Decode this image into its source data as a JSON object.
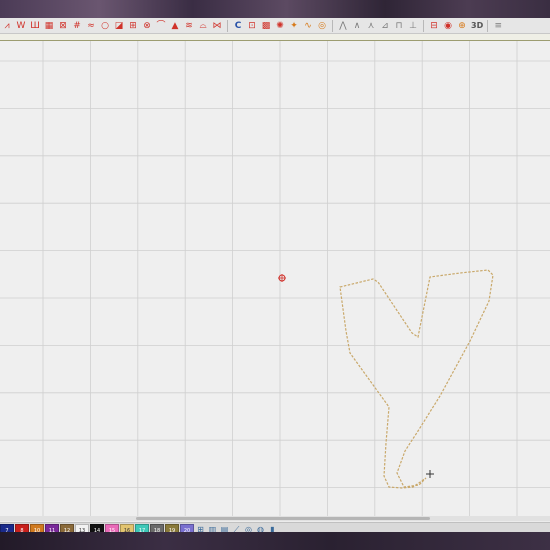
{
  "toolbar": {
    "tools": [
      {
        "name": "satin-column-tool",
        "glyph": "⩘",
        "color": "red"
      },
      {
        "name": "zigzag-tool",
        "glyph": "W",
        "color": "red"
      },
      {
        "name": "running-stitch-tool",
        "glyph": "Ш",
        "color": "red"
      },
      {
        "name": "fill-pattern-tool",
        "glyph": "▦",
        "color": "red"
      },
      {
        "name": "cross-stitch-tool",
        "glyph": "⊠",
        "color": "red"
      },
      {
        "name": "grid-fill-tool",
        "glyph": "#",
        "color": "red"
      },
      {
        "name": "wave-fill-tool",
        "glyph": "≈",
        "color": "red"
      },
      {
        "name": "ring-tool",
        "glyph": "○",
        "color": "red"
      },
      {
        "name": "motif-tool",
        "glyph": "◪",
        "color": "red"
      },
      {
        "name": "lattice-tool",
        "glyph": "⊞",
        "color": "red"
      },
      {
        "name": "diamond-fill-tool",
        "glyph": "⊗",
        "color": "red"
      },
      {
        "name": "arch-tool",
        "glyph": "⌒",
        "color": "red"
      },
      {
        "name": "triangle-fill-tool",
        "glyph": "▲",
        "color": "red"
      },
      {
        "name": "chevron-tool",
        "glyph": "≋",
        "color": "red"
      },
      {
        "name": "scallop-tool",
        "glyph": "⌓",
        "color": "red"
      },
      {
        "name": "tatami-tool",
        "glyph": "⋈",
        "color": "red"
      },
      {
        "name": "crescent-tool",
        "glyph": "C",
        "color": "blue"
      },
      {
        "name": "stitch-path-tool",
        "glyph": "⊡",
        "color": "red"
      },
      {
        "name": "weave-tool",
        "glyph": "▩",
        "color": "red"
      },
      {
        "name": "radial-fill-tool",
        "glyph": "✺",
        "color": "red"
      },
      {
        "name": "star-tool",
        "glyph": "✦",
        "color": "orange"
      },
      {
        "name": "wave-line-tool",
        "glyph": "∿",
        "color": "orange"
      },
      {
        "name": "spiral-tool",
        "glyph": "◎",
        "color": "orange"
      },
      {
        "name": "compass-tool",
        "glyph": "⋀",
        "color": "gray"
      },
      {
        "name": "angle-tool",
        "glyph": "∧",
        "color": "gray"
      },
      {
        "name": "peak-tool",
        "glyph": "⋏",
        "color": "gray"
      },
      {
        "name": "chart-tool",
        "glyph": "⊿",
        "color": "gray"
      },
      {
        "name": "hoop-tool",
        "glyph": "⊓",
        "color": "gray"
      },
      {
        "name": "measure-tool",
        "glyph": "⊥",
        "color": "gray"
      },
      {
        "name": "grid-toggle-tool",
        "glyph": "⊟",
        "color": "red"
      },
      {
        "name": "color-wheel-tool",
        "glyph": "◉",
        "color": "red"
      },
      {
        "name": "zoom-tool",
        "glyph": "⊕",
        "color": "orange"
      }
    ],
    "view_3d_label": "3D"
  },
  "palette": {
    "swatches": [
      {
        "label": "7",
        "color": "#1a2a8a"
      },
      {
        "label": "8",
        "color": "#c8201c"
      },
      {
        "label": "10",
        "color": "#d07a20"
      },
      {
        "label": "11",
        "color": "#7a2a9a"
      },
      {
        "label": "12",
        "color": "#8a6a3a"
      },
      {
        "label": "13",
        "color": "#f2f2f2"
      },
      {
        "label": "14",
        "color": "#111111"
      },
      {
        "label": "15",
        "color": "#e96ab8"
      },
      {
        "label": "16",
        "color": "#e2c470"
      },
      {
        "label": "17",
        "color": "#3ec8b8"
      },
      {
        "label": "18",
        "color": "#6a6a6a"
      },
      {
        "label": "19",
        "color": "#8a7a3a"
      },
      {
        "label": "20",
        "color": "#7a70d0"
      }
    ]
  },
  "colors": {
    "grid_line": "#cfcfcf",
    "outline": "#c9a86a",
    "origin_marker": "#d0302a",
    "cursor": "#333333"
  }
}
